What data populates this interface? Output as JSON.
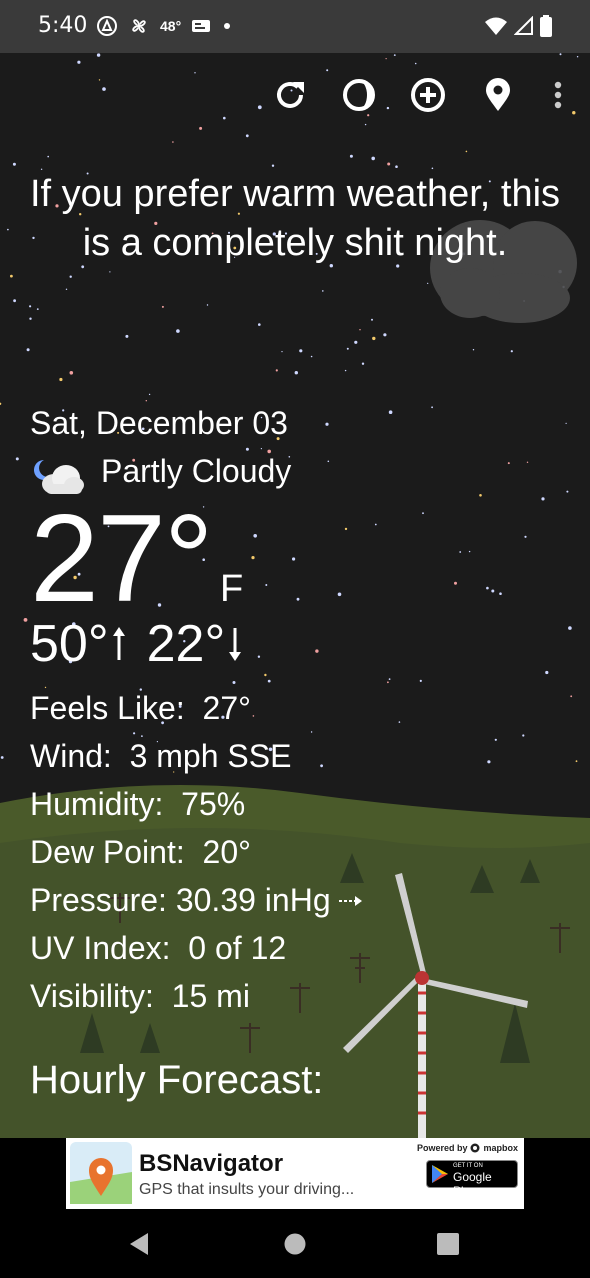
{
  "status_bar": {
    "time": "5:40",
    "temperature": "48°",
    "icons": [
      "hotspot-icon",
      "fan-icon",
      "temp-icon",
      "card-icon",
      "dot-icon",
      "wifi-icon",
      "signal-icon",
      "battery-icon"
    ]
  },
  "toolbar": {
    "icons": [
      "refresh-icon",
      "moon-icon",
      "add-location-icon",
      "location-pin-icon",
      "overflow-menu-icon"
    ]
  },
  "headline": "If you prefer warm weather, this is a completely shit night.",
  "weather": {
    "date": "Sat, December 03",
    "condition": "Partly Cloudy",
    "temperature": "27°",
    "unit": "F",
    "high": "50°",
    "low": "22°",
    "details": [
      {
        "label": "Feels Like:",
        "value": "27°"
      },
      {
        "label": "Wind:",
        "value": "3 mph SSE"
      },
      {
        "label": "Humidity:",
        "value": "75%"
      },
      {
        "label": "Dew Point:",
        "value": "20°"
      },
      {
        "label": "Pressure:",
        "value": "30.39 inHg"
      },
      {
        "label": "UV Index:",
        "value": "0 of 12"
      },
      {
        "label": "Visibility:",
        "value": "15 mi"
      }
    ],
    "hourly_heading": "Hourly Forecast:"
  },
  "ad": {
    "title": "BSNavigator",
    "subtitle": "GPS that insults your driving...",
    "powered_by": "Powered by",
    "brand": "mapbox",
    "store_small": "GET IT ON",
    "store_name": "Google Play"
  },
  "colors": {
    "status_bar": "#3a3a3a",
    "sky": "#1b1b1b",
    "hill": "#4a5a2a",
    "ad_background": "#ffffff"
  }
}
